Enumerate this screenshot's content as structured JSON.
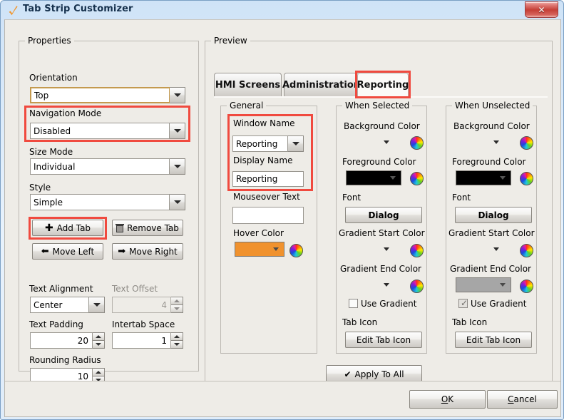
{
  "window": {
    "title": "Tab Strip Customizer",
    "icon": "wrench-icon",
    "close_label": "✕"
  },
  "properties": {
    "legend": "Properties",
    "orientation": {
      "label": "Orientation",
      "value": "Top"
    },
    "navigation_mode": {
      "label": "Navigation Mode",
      "value": "Disabled"
    },
    "size_mode": {
      "label": "Size Mode",
      "value": "Individual"
    },
    "style": {
      "label": "Style",
      "value": "Simple"
    },
    "buttons": {
      "add_tab": "Add Tab",
      "remove_tab": "Remove Tab",
      "move_left": "Move Left",
      "move_right": "Move Right"
    },
    "text_alignment": {
      "label": "Text Alignment",
      "value": "Center"
    },
    "text_offset": {
      "label": "Text Offset",
      "value": "4"
    },
    "text_padding": {
      "label": "Text Padding",
      "value": "20"
    },
    "intertab_space": {
      "label": "Intertab Space",
      "value": "1"
    },
    "rounding_radius": {
      "label": "Rounding Radius",
      "value": "10"
    }
  },
  "preview": {
    "legend": "Preview",
    "tabs": [
      {
        "label": "HMI Screens",
        "selected": false
      },
      {
        "label": "Administration",
        "selected": false
      },
      {
        "label": "Reporting",
        "selected": true
      }
    ],
    "general": {
      "legend": "General",
      "window_name": {
        "label": "Window Name",
        "value": "Reporting"
      },
      "display_name": {
        "label": "Display Name",
        "value": "Reporting"
      },
      "mouseover_text": {
        "label": "Mouseover Text",
        "value": ""
      },
      "hover_color": {
        "label": "Hover Color",
        "value": "#f0922e"
      }
    },
    "when_selected": {
      "legend": "When Selected",
      "background_color": {
        "label": "Background Color",
        "value": ""
      },
      "foreground_color": {
        "label": "Foreground Color",
        "value": "#000000"
      },
      "font": {
        "label": "Font",
        "value": "Dialog"
      },
      "gradient_start_color": {
        "label": "Gradient Start Color",
        "value": ""
      },
      "gradient_end_color": {
        "label": "Gradient End Color",
        "value": ""
      },
      "use_gradient": {
        "label": "Use Gradient",
        "checked": false
      },
      "tab_icon": {
        "label": "Tab Icon",
        "button": "Edit Tab Icon"
      }
    },
    "when_unselected": {
      "legend": "When Unselected",
      "background_color": {
        "label": "Background Color",
        "value": ""
      },
      "foreground_color": {
        "label": "Foreground Color",
        "value": "#000000"
      },
      "font": {
        "label": "Font",
        "value": "Dialog"
      },
      "gradient_start_color": {
        "label": "Gradient Start Color",
        "value": ""
      },
      "gradient_end_color": {
        "label": "Gradient End Color",
        "value": "#a6a6a6"
      },
      "use_gradient": {
        "label": "Use Gradient",
        "checked": true
      },
      "tab_icon": {
        "label": "Tab Icon",
        "button": "Edit Tab Icon"
      }
    },
    "apply_to_all": "Apply To All"
  },
  "footer": {
    "ok_mnemonic": "O",
    "ok_rest": "K",
    "cancel_mnemonic": "C",
    "cancel_rest": "ancel"
  },
  "colors": {
    "highlight": "#f04a3f",
    "dialog_bg": "#eeece7",
    "accent_focus": "#c49a4f"
  }
}
